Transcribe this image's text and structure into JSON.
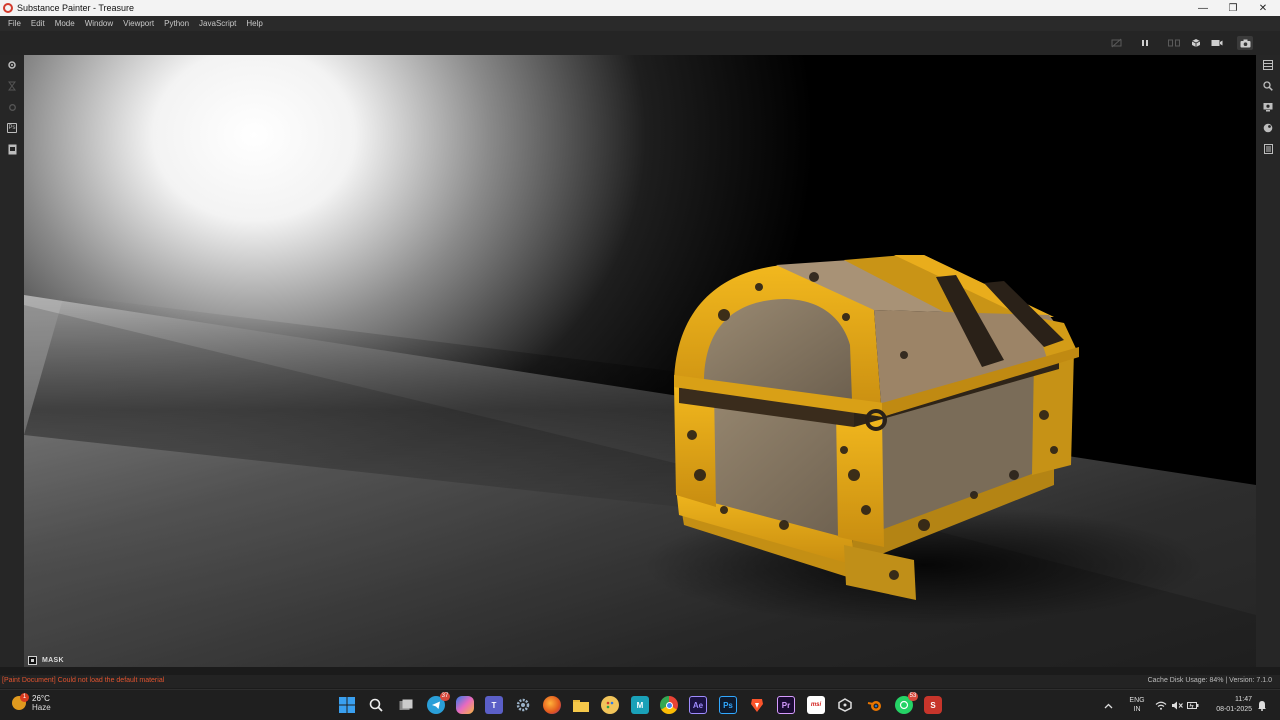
{
  "window": {
    "title": "Substance Painter - Treasure",
    "controls": {
      "minimize": "—",
      "maximize": "❐",
      "close": "✕"
    }
  },
  "menu": [
    "File",
    "Edit",
    "Mode",
    "Window",
    "Viewport",
    "Python",
    "JavaScript",
    "Help"
  ],
  "toolbar": {
    "icons": [
      "solo-mode-icon",
      "pause-icon",
      "split-view-icon",
      "cube-view-icon",
      "camera-icon",
      "screenshot-icon"
    ]
  },
  "left_tools": [
    "settings-icon",
    "hourglass-icon",
    "settings-dim-icon",
    "photoshop-export-icon",
    "document-icon"
  ],
  "right_tools": [
    "layers-icon",
    "zoom-icon",
    "display-settings-icon",
    "environment-icon",
    "notes-icon"
  ],
  "viewport": {
    "mask_label": "MASK"
  },
  "status": {
    "error": "[Paint Document] Could not load the default material",
    "cache": "Cache Disk Usage:   84% | Version: 7.1.0"
  },
  "taskbar": {
    "weather": {
      "temp": "26°C",
      "condition": "Haze",
      "badge": "1"
    },
    "apps": [
      {
        "name": "start-button",
        "label": ""
      },
      {
        "name": "search-button",
        "label": ""
      },
      {
        "name": "task-view-button",
        "label": ""
      },
      {
        "name": "telegram-app",
        "label": "",
        "badge": "37"
      },
      {
        "name": "copilot-app",
        "label": ""
      },
      {
        "name": "teams-app",
        "label": ""
      },
      {
        "name": "settings-app",
        "label": ""
      },
      {
        "name": "firefox-app",
        "label": ""
      },
      {
        "name": "file-explorer-app",
        "label": ""
      },
      {
        "name": "paint-app",
        "label": ""
      },
      {
        "name": "maya-app",
        "label": "M"
      },
      {
        "name": "chrome-app",
        "label": ""
      },
      {
        "name": "after-effects-app",
        "label": "Ae"
      },
      {
        "name": "photoshop-app",
        "label": "Ps"
      },
      {
        "name": "brave-app",
        "label": ""
      },
      {
        "name": "premiere-app",
        "label": "Pr"
      },
      {
        "name": "msi-app",
        "label": "msi"
      },
      {
        "name": "unity-app",
        "label": ""
      },
      {
        "name": "blender-app",
        "label": ""
      },
      {
        "name": "whatsapp-app",
        "label": "",
        "badge": "53"
      },
      {
        "name": "substance-painter-app",
        "label": "S"
      }
    ],
    "lang": {
      "line1": "ENG",
      "line2": "IN"
    },
    "clock": {
      "time": "11:47",
      "date": "08-01-2025"
    }
  }
}
